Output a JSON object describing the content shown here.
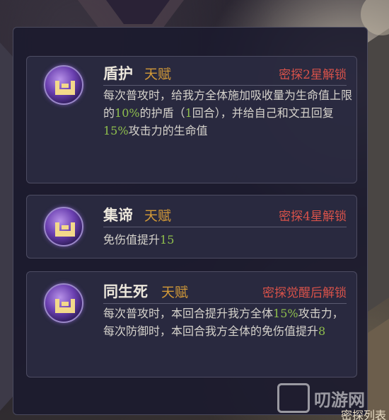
{
  "talents": [
    {
      "name": "盾护",
      "tag": "天赋",
      "unlock": "密探2星解锁",
      "icon": "shield-emblem-icon",
      "desc": [
        {
          "t": "每次普攻时，给我方全体施加吸收量为生命值上限的"
        },
        {
          "t": "10%",
          "hl": true
        },
        {
          "t": "的护盾（"
        },
        {
          "t": "1",
          "hl": true
        },
        {
          "t": "回合），并给自己和文丑回复"
        },
        {
          "t": "15%",
          "hl": true
        },
        {
          "t": "攻击力的生命值"
        }
      ]
    },
    {
      "name": "集谛",
      "tag": "天赋",
      "unlock": "密探4星解锁",
      "icon": "shield-emblem-icon",
      "desc": [
        {
          "t": "免伤值提升"
        },
        {
          "t": "15",
          "hl": true
        }
      ]
    },
    {
      "name": "同生死",
      "tag": "天赋",
      "unlock": "密探觉醒后解锁",
      "icon": "shield-emblem-icon",
      "desc": [
        {
          "t": "每次普攻时，本回合提升我方全体"
        },
        {
          "t": "15%",
          "hl": true
        },
        {
          "t": "攻击力，每次防御时，本回合我方全体的免伤值提升"
        },
        {
          "t": "8",
          "hl": true
        }
      ]
    }
  ],
  "watermark": "叨游网",
  "bottom_label": "密探列表",
  "colors": {
    "tag": "#d39a38",
    "unlock": "#d8524a",
    "highlight": "#8fbf4d",
    "panel": "#1c1b2e"
  }
}
